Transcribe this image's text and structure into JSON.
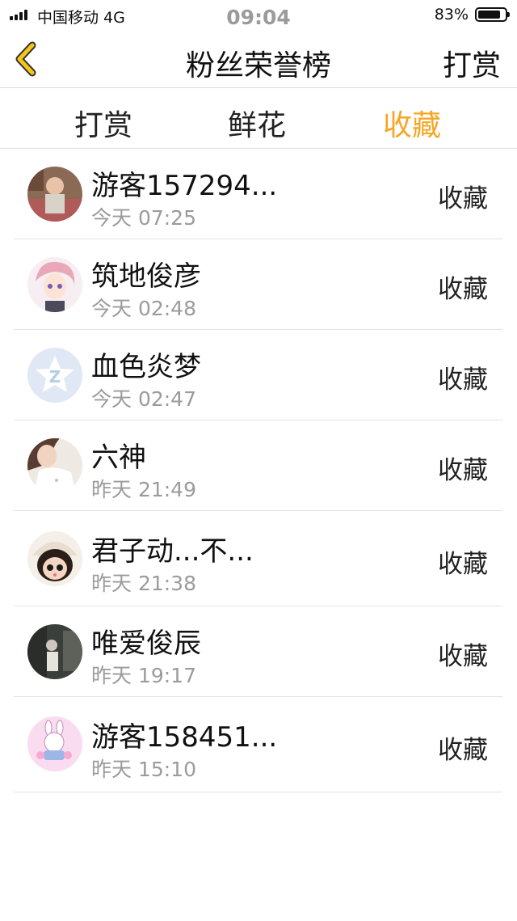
{
  "status_bar": {
    "carrier": "中国移动  4G",
    "time": "09:04",
    "battery_percent": "83%",
    "battery_level": 0.83
  },
  "nav": {
    "title": "粉丝荣誉榜",
    "action": "打赏"
  },
  "tabs": [
    {
      "label": "打赏",
      "active": false
    },
    {
      "label": "鲜花",
      "active": false
    },
    {
      "label": "收藏",
      "active": true
    }
  ],
  "colors": {
    "accent": "#f5a623",
    "divider": "#e3e3e3",
    "secondary_text": "#9b9b9b"
  },
  "list": [
    {
      "name": "游客157294...",
      "time": "今天 07:25",
      "kind": "收藏",
      "avatar": "photo-avatar"
    },
    {
      "name": "筑地俊彦",
      "time": "今天 02:48",
      "kind": "收藏",
      "avatar": "anime-avatar"
    },
    {
      "name": "血色炎梦",
      "time": "今天 02:47",
      "kind": "收藏",
      "avatar": "default-star-avatar"
    },
    {
      "name": "六神",
      "time": "昨天 21:49",
      "kind": "收藏",
      "avatar": "photo-avatar"
    },
    {
      "name": "君子动...不...",
      "time": "昨天 21:38",
      "kind": "收藏",
      "avatar": "doll-avatar"
    },
    {
      "name": "唯爱俊辰",
      "time": "昨天 19:17",
      "kind": "收藏",
      "avatar": "photo-avatar"
    },
    {
      "name": "游客158451...",
      "time": "昨天 15:10",
      "kind": "收藏",
      "avatar": "cartoon-avatar"
    }
  ]
}
